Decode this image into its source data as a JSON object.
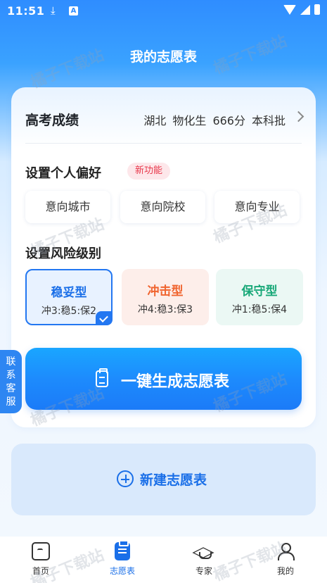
{
  "status_bar": {
    "time": "11:51",
    "download_icon": "download-icon",
    "notif_letter": "A"
  },
  "header": {
    "title": "我的志愿表"
  },
  "score": {
    "label": "高考成绩",
    "province": "湖北",
    "subject": "物化生",
    "points": "666分",
    "batch": "本科批"
  },
  "preference": {
    "title": "设置个人偏好",
    "badge": "新功能",
    "buttons": [
      "意向城市",
      "意向院校",
      "意向专业"
    ]
  },
  "risk": {
    "title": "设置风险级别",
    "options": [
      {
        "name": "稳妥型",
        "ratio": "冲3:稳5:保2",
        "selected": true,
        "color": "#1a6fe8"
      },
      {
        "name": "冲击型",
        "ratio": "冲4:稳3:保3",
        "selected": false,
        "color": "#f0642f"
      },
      {
        "name": "保守型",
        "ratio": "冲1:稳5:保4",
        "selected": false,
        "color": "#18a878"
      }
    ]
  },
  "generate_button": {
    "label": "一键生成志愿表",
    "icon": "clipboard-icon"
  },
  "side_tab": {
    "chars": [
      "联",
      "系",
      "客",
      "服"
    ]
  },
  "new_table": {
    "label": "新建志愿表",
    "icon": "plus-circle-icon"
  },
  "tabbar": {
    "items": [
      {
        "label": "首页",
        "icon": "home-icon",
        "active": false
      },
      {
        "label": "志愿表",
        "icon": "list-icon",
        "active": true
      },
      {
        "label": "专家",
        "icon": "graduation-cap-icon",
        "active": false
      },
      {
        "label": "我的",
        "icon": "user-icon",
        "active": false
      }
    ]
  },
  "watermark": "橘子下载站"
}
